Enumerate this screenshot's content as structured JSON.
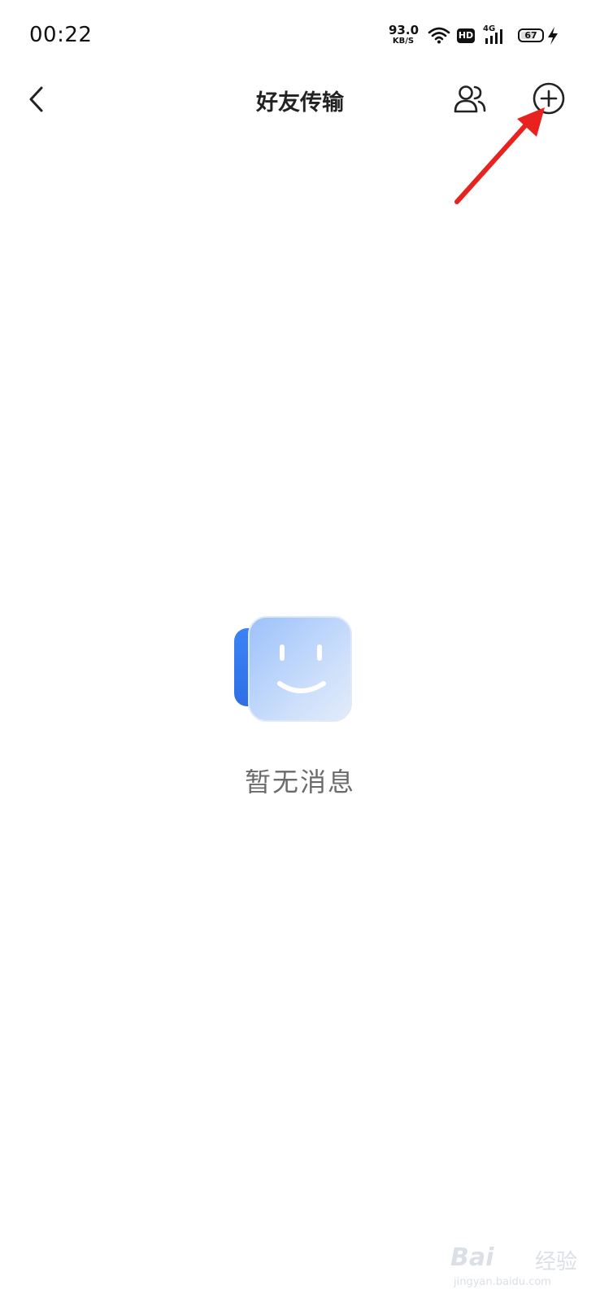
{
  "status_bar": {
    "time": "00:22",
    "net_speed_value": "93.0",
    "net_speed_unit": "KB/S",
    "hd_label": "HD",
    "network_label": "4G",
    "battery_level": "67"
  },
  "header": {
    "title": "好友传输",
    "back_icon": "chevron-left-icon",
    "friends_icon": "friends-icon",
    "add_icon": "add-circle-icon"
  },
  "empty_state": {
    "message": "暂无消息",
    "illustration_icon": "smiley-icon"
  },
  "watermark": {
    "brand": "Bai",
    "brand_cn": "经验",
    "url": "jingyan.baidu.com"
  },
  "colors": {
    "annotation_arrow": "#e8231f",
    "illustration_blue": "#3b82f6"
  }
}
